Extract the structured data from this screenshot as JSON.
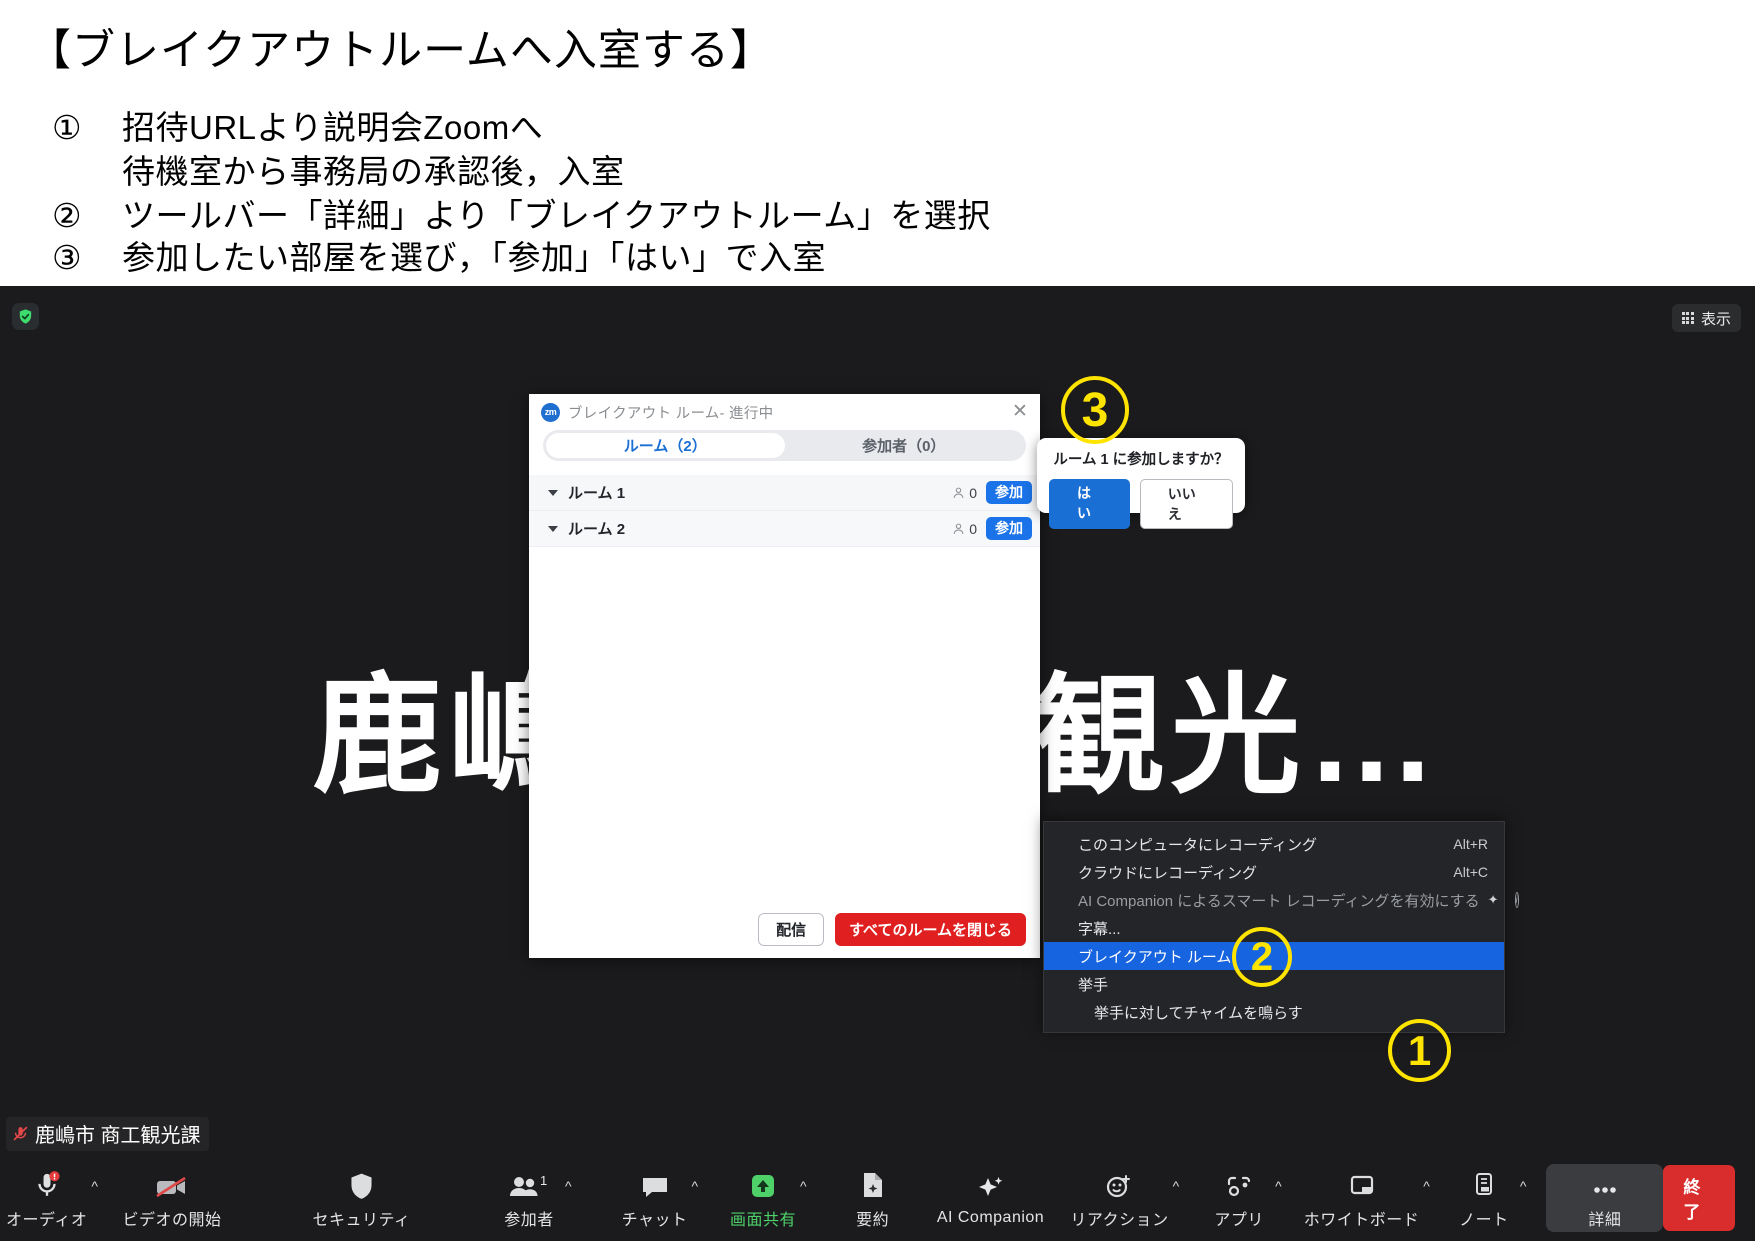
{
  "slide": {
    "title": "【ブレイクアウトルームへ入室する】",
    "bullets": [
      {
        "num": "①",
        "text": "招待URLより説明会Zoomへ"
      },
      {
        "num": "",
        "text": "待機室から事務局の承認後，入室"
      },
      {
        "num": "②",
        "text": "ツールバー「詳細」より「ブレイクアウトルーム」を選択"
      },
      {
        "num": "③",
        "text": "参加したい部屋を選び，「参加」「はい」で入室"
      }
    ]
  },
  "stage": {
    "background_text": "鹿嶋市 商工観光…",
    "security_icon": "shield-check-icon",
    "view_button_label": "表示",
    "view_button_icon": "grid-icon",
    "user_name": "鹿嶋市 商工観光課",
    "user_mute_icon": "microphone-muted-icon"
  },
  "breakout_dialog": {
    "logo_text": "zm",
    "title": "ブレイクアウト ルーム- 進行中",
    "close_icon": "close-icon",
    "tabs": [
      {
        "label": "ルーム（2）",
        "active": true
      },
      {
        "label": "参加者（0）",
        "active": false
      }
    ],
    "rooms": [
      {
        "name": "ルーム 1",
        "count": "0",
        "join_label": "参加"
      },
      {
        "name": "ルーム 2",
        "count": "0",
        "join_label": "参加"
      }
    ],
    "footer": {
      "broadcast_label": "配信",
      "close_all_label": "すべてのルームを閉じる"
    }
  },
  "join_confirm": {
    "message": "ルーム 1 に参加しますか？",
    "yes_label": "はい",
    "no_label": "いいえ"
  },
  "more_menu": {
    "items": [
      {
        "label": "このコンピュータにレコーディング",
        "shortcut": "Alt+R",
        "state": "normal"
      },
      {
        "label": "クラウドにレコーディング",
        "shortcut": "Alt+C",
        "state": "normal"
      },
      {
        "label": "AI Companion によるスマート レコーディングを有効にする",
        "shortcut": "",
        "state": "dim"
      },
      {
        "label": "字幕...",
        "shortcut": "",
        "state": "normal"
      },
      {
        "label": "ブレイクアウト ルーム",
        "shortcut": "",
        "state": "highlight"
      },
      {
        "label": "挙手",
        "shortcut": "",
        "state": "normal"
      },
      {
        "label": "挙手に対してチャイムを鳴らす",
        "shortcut": "",
        "state": "sub"
      }
    ]
  },
  "toolbar": {
    "items": [
      {
        "label": "オーディオ",
        "icon": "microphone-warning-icon",
        "caret": true,
        "badge": ""
      },
      {
        "label": "ビデオの開始",
        "icon": "video-off-icon",
        "caret": false,
        "badge": ""
      },
      {
        "label": "セキュリティ",
        "icon": "shield-icon",
        "caret": false,
        "badge": ""
      },
      {
        "label": "参加者",
        "icon": "participants-icon",
        "caret": true,
        "badge": "1"
      },
      {
        "label": "チャット",
        "icon": "chat-icon",
        "caret": true,
        "badge": ""
      },
      {
        "label": "画面共有",
        "icon": "share-screen-icon",
        "caret": true,
        "badge": ""
      },
      {
        "label": "要約",
        "icon": "summary-doc-icon",
        "caret": false,
        "badge": ""
      },
      {
        "label": "AI Companion",
        "icon": "sparkle-icon",
        "caret": false,
        "badge": ""
      },
      {
        "label": "リアクション",
        "icon": "reactions-icon",
        "caret": true,
        "badge": ""
      },
      {
        "label": "アプリ",
        "icon": "apps-icon",
        "caret": true,
        "badge": ""
      },
      {
        "label": "ホワイトボード",
        "icon": "whiteboard-icon",
        "caret": true,
        "badge": ""
      },
      {
        "label": "ノート",
        "icon": "notes-icon",
        "caret": true,
        "badge": ""
      },
      {
        "label": "詳細",
        "icon": "more-dots-icon",
        "caret": false,
        "badge": ""
      }
    ],
    "end_label": "終了"
  },
  "annotations": {
    "step1": "1",
    "step2": "2",
    "step3": "3"
  },
  "colors": {
    "accent_blue": "#1a73e8",
    "danger_red": "#e02020",
    "highlight_blue": "#1764e0",
    "annotation_yellow": "#ffe400",
    "share_green": "#4ed169"
  }
}
